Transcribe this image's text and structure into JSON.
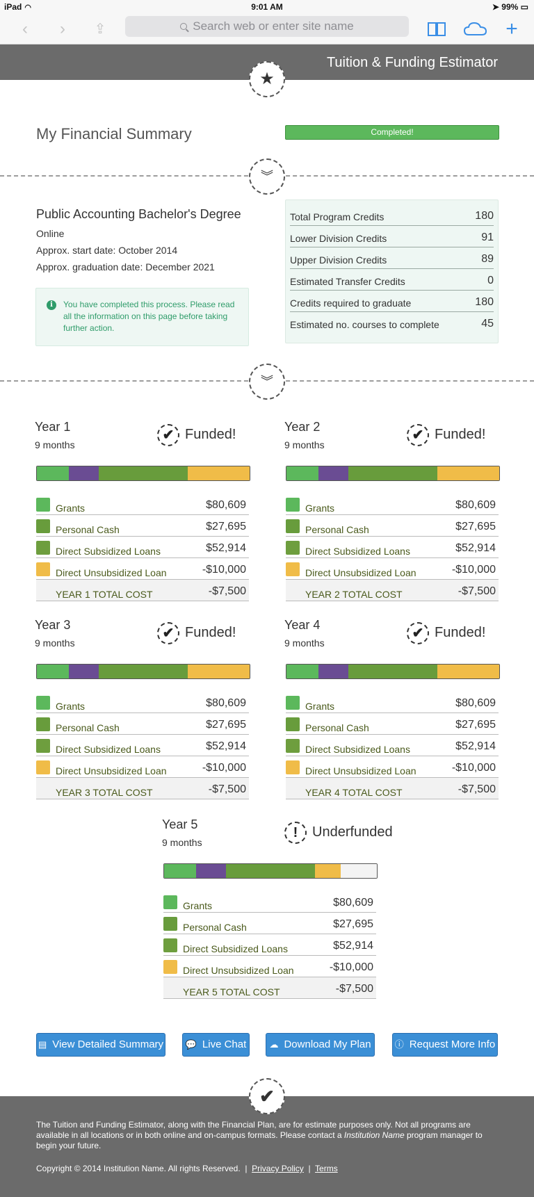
{
  "status_bar": {
    "device": "iPad",
    "time": "9:01 AM",
    "battery": "99%"
  },
  "toolbar": {
    "search_placeholder": "Search web or enter site name"
  },
  "header": {
    "title": "Tuition & Funding Estimator"
  },
  "summary": {
    "title": "My Financial Summary",
    "progress_label": "Completed!",
    "progress": 1.0
  },
  "program": {
    "name": "Public Accounting Bachelor's Degree",
    "format": "Online",
    "start": "Approx. start date: October 2014",
    "graduation": "Approx. graduation date: December 2021",
    "alert": "You have completed this process. Please read all the information on this page before taking further action."
  },
  "credits": [
    {
      "label": "Total Program Credits",
      "value": "180"
    },
    {
      "label": "Lower Division Credits",
      "value": "91"
    },
    {
      "label": "Upper Division Credits",
      "value": "89"
    },
    {
      "label": "Estimated Transfer Credits",
      "value": "0"
    },
    {
      "label": "Credits required to graduate",
      "value": "180"
    },
    {
      "label": "Estimated no. courses to complete",
      "value": "45"
    }
  ],
  "colors": {
    "grants": "#5cb85c",
    "purple": "#6a4c93",
    "personal_cash": "#689c3c",
    "direct_subsidized": "#6e9e3e",
    "direct_unsubsidized": "#f0bc48",
    "empty": "#f4f4f4"
  },
  "years": [
    {
      "title": "Year 1",
      "duration": "9 months",
      "status": "Funded!",
      "status_icon": "check-icon",
      "rows": [
        {
          "label": "Grants",
          "value": "$80,609"
        },
        {
          "label": "Personal Cash",
          "value": "$27,695"
        },
        {
          "label": "Direct Subsidized Loans",
          "value": "$52,914"
        },
        {
          "label": "Direct Unsubsidized Loan",
          "value": "-$10,000"
        }
      ],
      "total_label": "YEAR 1 TOTAL COST",
      "total_value": "-$7,500"
    },
    {
      "title": "Year 2",
      "duration": "9 months",
      "status": "Funded!",
      "status_icon": "check-icon",
      "rows": [
        {
          "label": "Grants",
          "value": "$80,609"
        },
        {
          "label": "Personal Cash",
          "value": "$27,695"
        },
        {
          "label": "Direct Subsidized Loans",
          "value": "$52,914"
        },
        {
          "label": "Direct Unsubsidized Loan",
          "value": "-$10,000"
        }
      ],
      "total_label": "YEAR 2 TOTAL COST",
      "total_value": "-$7,500"
    },
    {
      "title": "Year 3",
      "duration": "9 months",
      "status": "Funded!",
      "status_icon": "check-icon",
      "rows": [
        {
          "label": "Grants",
          "value": "$80,609"
        },
        {
          "label": "Personal Cash",
          "value": "$27,695"
        },
        {
          "label": "Direct Subsidized Loans",
          "value": "$52,914"
        },
        {
          "label": "Direct Unsubsidized Loan",
          "value": "-$10,000"
        }
      ],
      "total_label": "YEAR 3 TOTAL COST",
      "total_value": "-$7,500"
    },
    {
      "title": "Year 4",
      "duration": "9 months",
      "status": "Funded!",
      "status_icon": "check-icon",
      "rows": [
        {
          "label": "Grants",
          "value": "$80,609"
        },
        {
          "label": "Personal Cash",
          "value": "$27,695"
        },
        {
          "label": "Direct Subsidized Loans",
          "value": "$52,914"
        },
        {
          "label": "Direct Unsubsidized Loan",
          "value": "-$10,000"
        }
      ],
      "total_label": "YEAR 4 TOTAL COST",
      "total_value": "-$7,500"
    },
    {
      "title": "Year 5",
      "duration": "9 months",
      "status": "Underfunded",
      "status_icon": "exclamation-icon",
      "rows": [
        {
          "label": "Grants",
          "value": "$80,609"
        },
        {
          "label": "Personal Cash",
          "value": "$27,695"
        },
        {
          "label": "Direct Subsidized Loans",
          "value": "$52,914"
        },
        {
          "label": "Direct Unsubsidized Loan",
          "value": "-$10,000"
        }
      ],
      "total_label": "YEAR 5 TOTAL COST",
      "total_value": "-$7,500"
    }
  ],
  "funding_bars": [
    [
      0.15,
      0.14,
      0.42,
      0.29,
      0.0
    ],
    [
      0.15,
      0.14,
      0.42,
      0.29,
      0.0
    ],
    [
      0.15,
      0.14,
      0.42,
      0.29,
      0.0
    ],
    [
      0.15,
      0.14,
      0.42,
      0.29,
      0.0
    ],
    [
      0.15,
      0.14,
      0.42,
      0.12,
      0.17
    ]
  ],
  "buttons": {
    "detailed_summary": "View Detailed Summary",
    "live_chat": "Live Chat",
    "download_plan": "Download My Plan",
    "request_info": "Request More Info"
  },
  "footer": {
    "text_part1": "The Tuition and Funding Estimator, along with the Financial Plan, are for estimate purposes only. Not all programs are available in all locations or in both online and on-campus formats. Please contact a ",
    "institution": "Institution Name",
    "text_part2": " program manager to begin your future.",
    "copyright": "Copyright © 2014 Institution Name. All rights Reserved.",
    "privacy": "Privacy Policy",
    "terms": "Terms"
  }
}
